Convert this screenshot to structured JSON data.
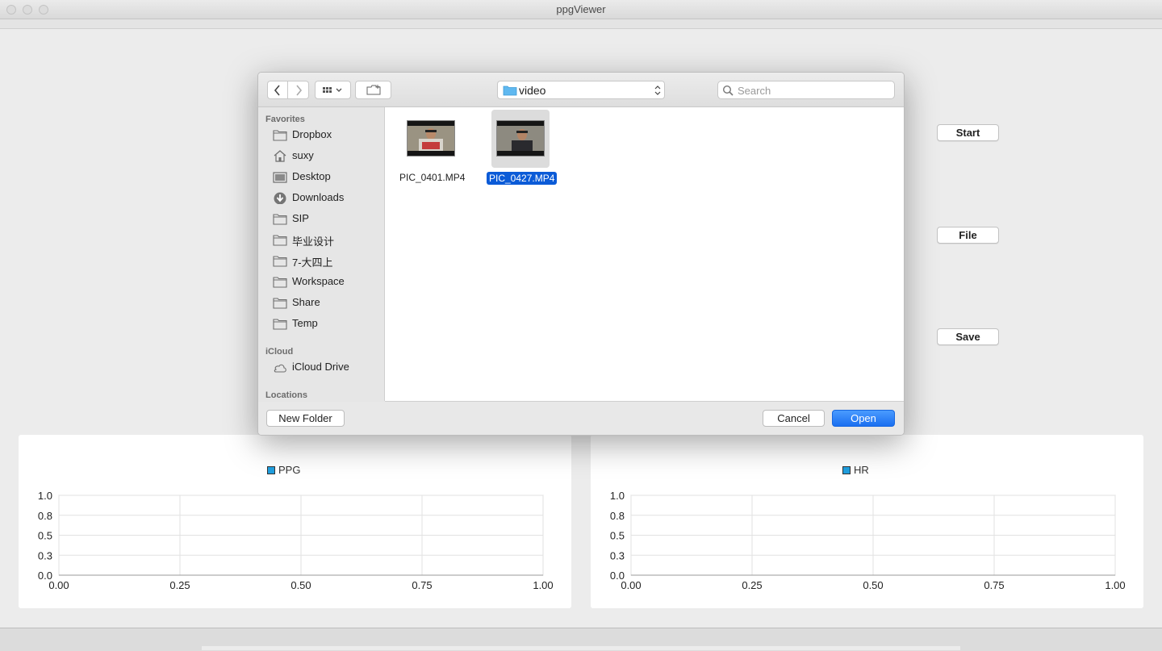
{
  "window": {
    "title": "ppgViewer"
  },
  "app_buttons": {
    "start": "Start",
    "file": "File",
    "save": "Save"
  },
  "dialog": {
    "path_popup": "video",
    "search_placeholder": "Search",
    "sidebar": {
      "favorites_header": "Favorites",
      "favorites": [
        {
          "label": "Dropbox",
          "icon": "folder-icon"
        },
        {
          "label": "suxy",
          "icon": "home-icon"
        },
        {
          "label": "Desktop",
          "icon": "desktop-icon"
        },
        {
          "label": "Downloads",
          "icon": "download-icon"
        },
        {
          "label": "SIP",
          "icon": "folder-icon"
        },
        {
          "label": "毕业设计",
          "icon": "folder-icon"
        },
        {
          "label": "7-大四上",
          "icon": "folder-icon"
        },
        {
          "label": "Workspace",
          "icon": "folder-icon"
        },
        {
          "label": "Share",
          "icon": "folder-icon"
        },
        {
          "label": "Temp",
          "icon": "folder-icon"
        }
      ],
      "icloud_header": "iCloud",
      "icloud": [
        {
          "label": "iCloud Drive",
          "icon": "cloud-icon"
        }
      ],
      "locations_header": "Locations"
    },
    "files": [
      {
        "name": "PIC_0401.MP4",
        "selected": false
      },
      {
        "name": "PIC_0427.MP4",
        "selected": true
      }
    ],
    "buttons": {
      "new_folder": "New Folder",
      "cancel": "Cancel",
      "open": "Open"
    }
  },
  "colors": {
    "accent": "#1a6ff0",
    "selection": "#0b5bd7",
    "series": "#209fdf"
  },
  "chart_data": [
    {
      "type": "line",
      "legend": [
        "PPG"
      ],
      "series": [
        {
          "name": "PPG",
          "values": []
        }
      ],
      "xlim": [
        0,
        1
      ],
      "ylim": [
        0,
        1
      ],
      "x_ticks": [
        "0.00",
        "0.25",
        "0.50",
        "0.75",
        "1.00"
      ],
      "y_ticks": [
        "0.0",
        "0.3",
        "0.5",
        "0.8",
        "1.0"
      ],
      "grid": true
    },
    {
      "type": "line",
      "legend": [
        "HR"
      ],
      "series": [
        {
          "name": "HR",
          "values": []
        }
      ],
      "xlim": [
        0,
        1
      ],
      "ylim": [
        0,
        1
      ],
      "x_ticks": [
        "0.00",
        "0.25",
        "0.50",
        "0.75",
        "1.00"
      ],
      "y_ticks": [
        "0.0",
        "0.3",
        "0.5",
        "0.8",
        "1.0"
      ],
      "grid": true
    }
  ]
}
